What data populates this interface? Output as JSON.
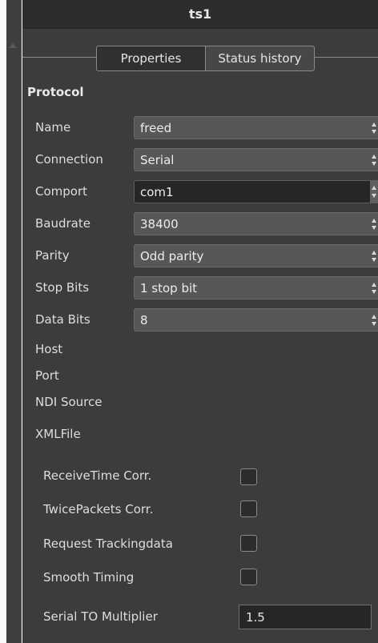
{
  "window": {
    "title": "ts1"
  },
  "tabs": [
    {
      "label": "Properties",
      "active": true
    },
    {
      "label": "Status history",
      "active": false
    }
  ],
  "section": {
    "title": "Protocol"
  },
  "fields": [
    {
      "label": "Name",
      "value": "freed"
    },
    {
      "label": "Connection",
      "value": "Serial"
    },
    {
      "label": "Comport",
      "value": "com1"
    },
    {
      "label": "Baudrate",
      "value": "38400"
    },
    {
      "label": "Parity",
      "value": "Odd parity"
    },
    {
      "label": "Stop Bits",
      "value": "1 stop bit"
    },
    {
      "label": "Data Bits",
      "value": "8"
    }
  ],
  "text_fields": [
    {
      "label": "Host"
    },
    {
      "label": "Port"
    },
    {
      "label": "NDI Source"
    },
    {
      "label": "XMLFile"
    }
  ],
  "checkboxes": [
    {
      "label": "ReceiveTime Corr.",
      "checked": false
    },
    {
      "label": "TwicePackets Corr.",
      "checked": false
    },
    {
      "label": "Request Trackingdata",
      "checked": false
    },
    {
      "label": "Smooth Timing",
      "checked": false
    }
  ],
  "serial_multiplier": {
    "label": "Serial TO Multiplier",
    "value": "1.5"
  },
  "colors": {
    "panel": "#3c3c3c",
    "titlebar": "#2d2d2d",
    "field": "#575757",
    "active_field": "#262626"
  },
  "icons": {
    "spin": "up-down-arrows-icon",
    "scroll": "scroll-up-arrow-icon"
  }
}
